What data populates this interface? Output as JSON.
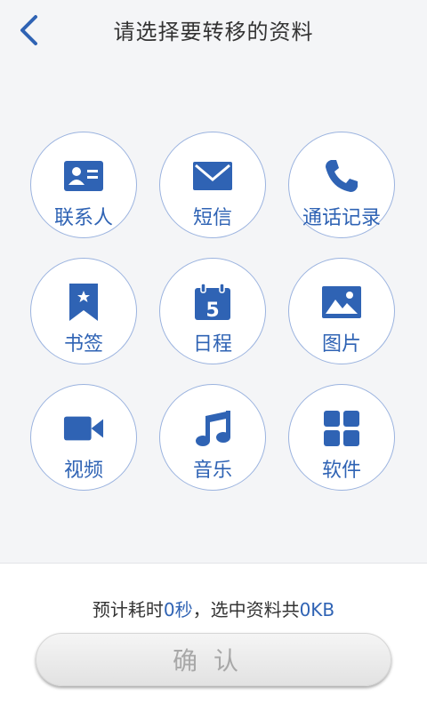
{
  "header": {
    "title": "请选择要转移的资料"
  },
  "items": [
    {
      "label": "联系人",
      "icon": "contact-card-icon"
    },
    {
      "label": "短信",
      "icon": "envelope-icon"
    },
    {
      "label": "通话记录",
      "icon": "phone-icon"
    },
    {
      "label": "书签",
      "icon": "bookmark-icon"
    },
    {
      "label": "日程",
      "icon": "calendar-icon",
      "day": "5"
    },
    {
      "label": "图片",
      "icon": "picture-icon"
    },
    {
      "label": "视频",
      "icon": "video-camera-icon"
    },
    {
      "label": "音乐",
      "icon": "music-note-icon"
    },
    {
      "label": "软件",
      "icon": "app-grid-icon"
    }
  ],
  "footer": {
    "summary_prefix": "预计耗时",
    "time_value": "0秒",
    "summary_mid": "，选中资料共",
    "size_value": "0KB",
    "confirm_label": "确认"
  },
  "colors": {
    "accent": "#2f63b4",
    "background": "#f4f5f7"
  }
}
